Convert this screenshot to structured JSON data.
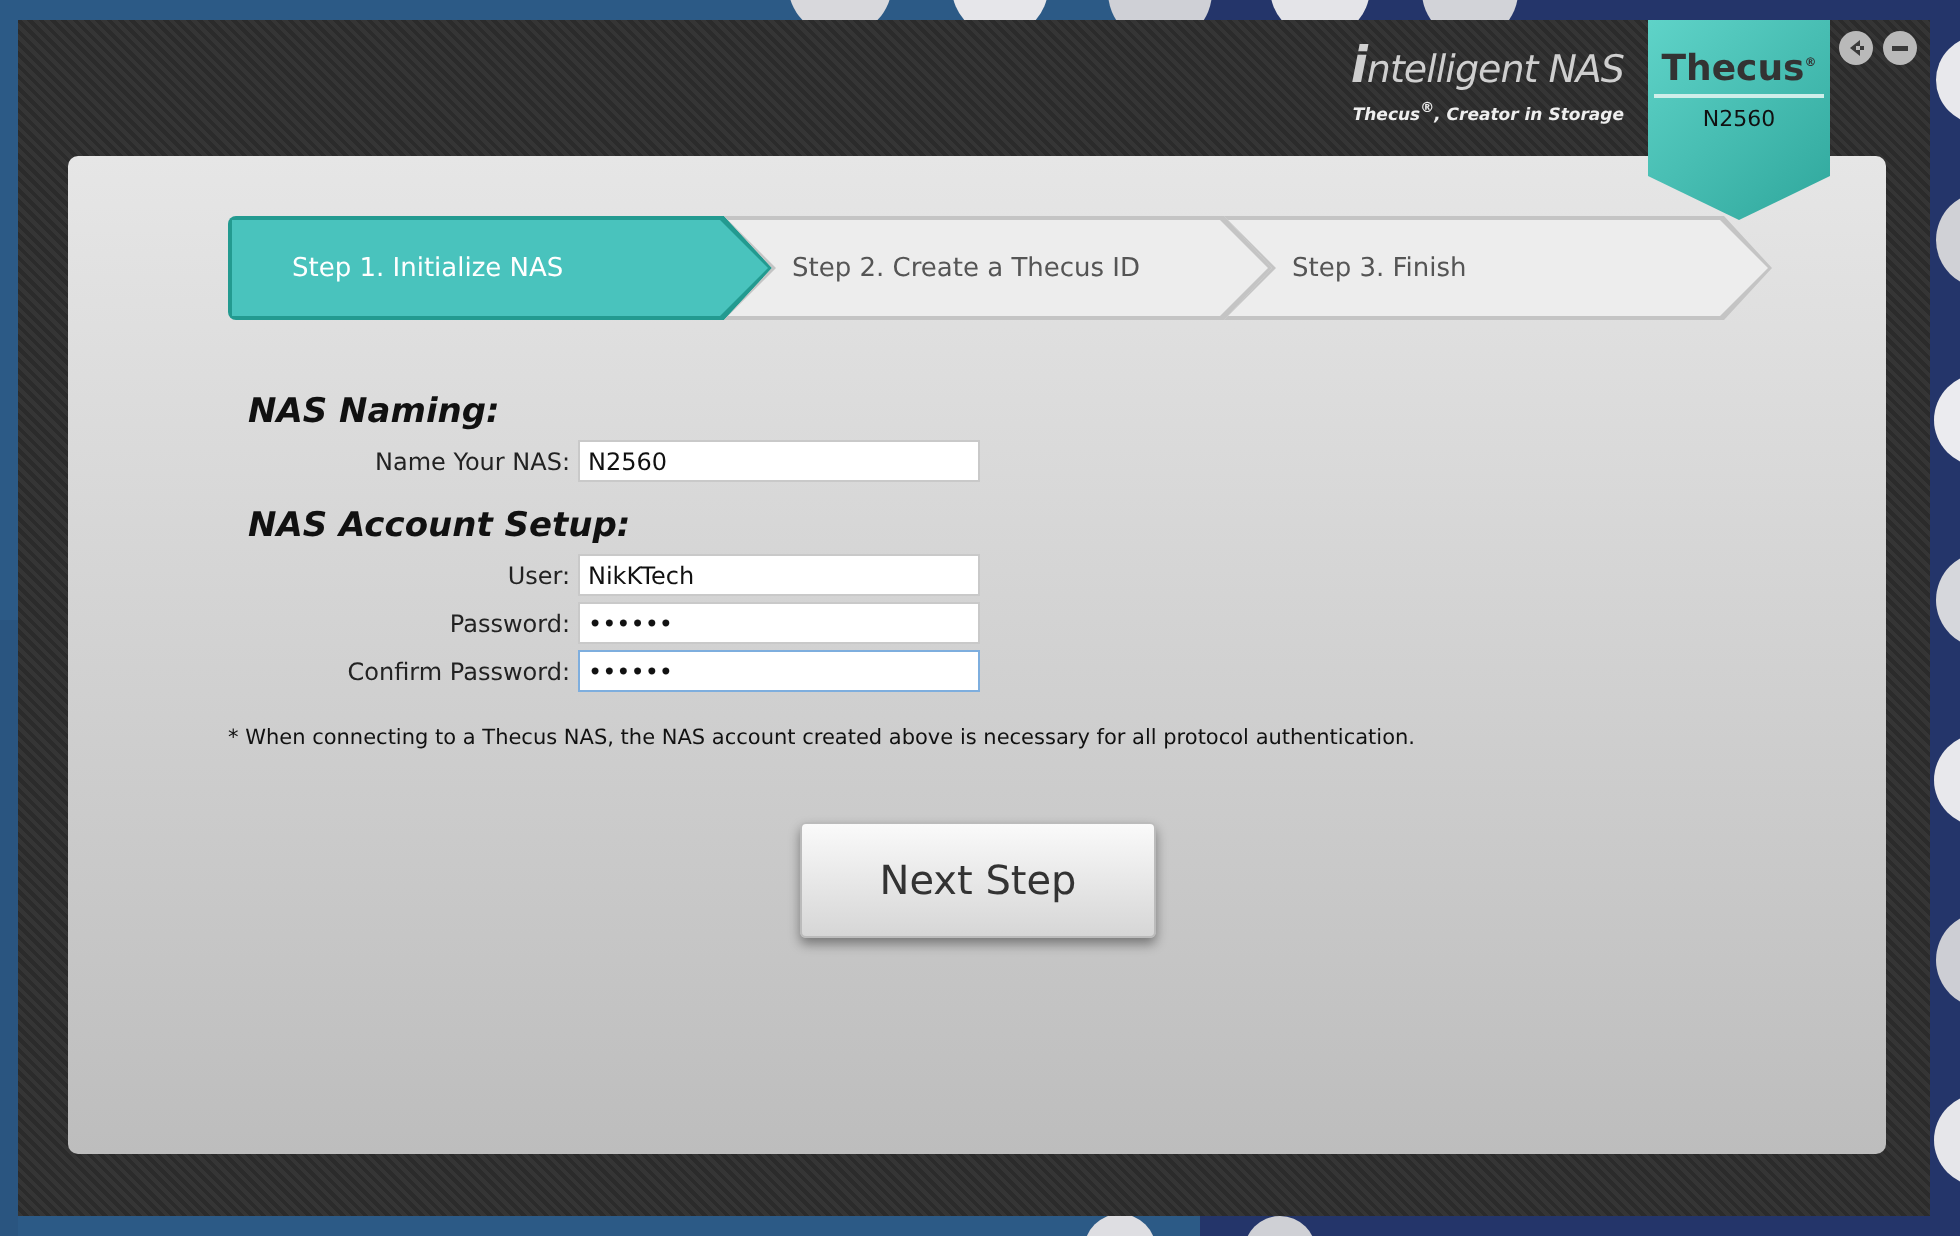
{
  "header": {
    "product": "intelligent NAS",
    "tagline": "Thecus$^{®}$, Creator in Storage",
    "badge_brand": "Thecus$^{®}$",
    "badge_model": "N2560"
  },
  "window_controls": [
    {
      "kind": "back"
    },
    {
      "kind": "minimize"
    }
  ],
  "steps": [
    {
      "label": "Step 1. Initialize NAS",
      "selected": true
    },
    {
      "label": "Step 2. Create a Thecus ID",
      "selected": false
    },
    {
      "label": "Step 3. Finish",
      "selected": false
    }
  ],
  "sections": [
    {
      "title": "NAS Naming:",
      "fields": [
        {
          "label": "Name Your NAS:",
          "value": "N2560",
          "focused": false
        }
      ]
    },
    {
      "title": "NAS Account Setup:",
      "fields": [
        {
          "label": "User:",
          "value": "NikKTech",
          "focused": false
        },
        {
          "label": "Password:",
          "value": "••••••",
          "focused": false
        },
        {
          "label": "Confirm Password:",
          "value": "••••••",
          "focused": true
        }
      ]
    }
  ],
  "note": "* When connecting to a Thecus NAS, the NAS account created above is necessary for all protocol authentication.",
  "button": "Next Step"
}
